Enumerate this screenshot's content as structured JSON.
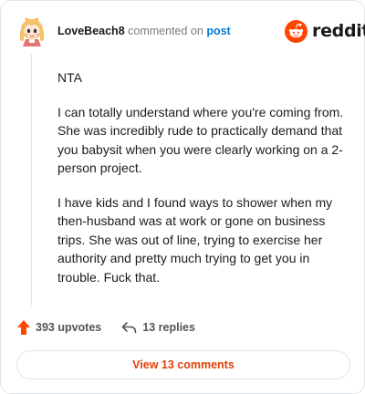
{
  "header": {
    "username": "LoveBeach8",
    "action_text": "commented on",
    "post_link": "post",
    "brand_name": "reddit",
    "avatar_icon": "anime-girl-avatar-icon",
    "brand_icon": "reddit-snoo-icon"
  },
  "comment": {
    "paragraphs": [
      "NTA",
      "I can totally understand where you're coming from. She was incredibly rude to practically demand that you babysit when you were clearly working on a 2-person project.",
      "I have kids and I found ways to shower when my then-husband was at work or gone on business trips. She was out of line, trying to exercise her authority and pretty much trying to get you in trouble. Fuck that."
    ]
  },
  "footer": {
    "upvotes": "393 upvotes",
    "replies": "13 replies",
    "view_comments": "View 13 comments"
  },
  "colors": {
    "brand_orange": "#ff4500",
    "link_blue": "#0079d3",
    "button_text": "#e0400c"
  }
}
